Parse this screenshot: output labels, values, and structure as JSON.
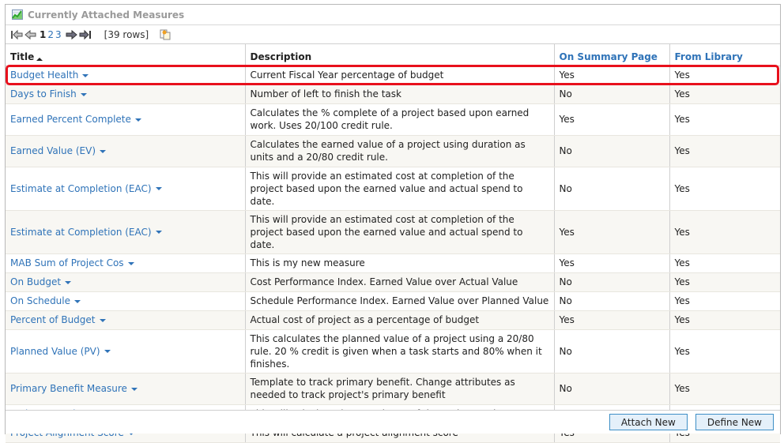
{
  "panel": {
    "title": "Currently Attached Measures",
    "icon": "chart-icon"
  },
  "toolbar": {
    "first_icon": "first-page-icon",
    "prev_icon": "prev-page-icon",
    "pages": [
      "1",
      "2",
      "3"
    ],
    "current_page": "1",
    "next_icon": "next-page-icon",
    "last_icon": "last-page-icon",
    "rows_count": "[39 rows]",
    "export_icon": "export-icon"
  },
  "table": {
    "columns": [
      "Title",
      "Description",
      "On Summary Page",
      "From Library"
    ],
    "sorted_column": "Title",
    "sort_direction": "ascending",
    "highlighted_row": 0,
    "rows": [
      {
        "title": "Budget Health",
        "description": "Current Fiscal Year percentage of budget",
        "summary": "Yes",
        "library": "Yes"
      },
      {
        "title": "Days to Finish",
        "description": "Number of left to finish the task",
        "summary": "No",
        "library": "Yes"
      },
      {
        "title": "Earned Percent Complete",
        "description": "Calculates the % complete of a project based upon earned work. Uses 20/100 credit rule.",
        "summary": "Yes",
        "library": "Yes"
      },
      {
        "title": "Earned Value (EV)",
        "description": "Calculates the earned value of a project using duration as units and a 20/80 credit rule.",
        "summary": "No",
        "library": "Yes"
      },
      {
        "title": "Estimate at Completion (EAC)",
        "description": "This will provide an estimated cost at completion of the project based upon the earned value and actual spend to date.",
        "summary": "No",
        "library": "Yes"
      },
      {
        "title": "Estimate at Completion (EAC)",
        "description": "This will provide an estimated cost at completion of the project based upon the earned value and actual spend to date.",
        "summary": "Yes",
        "library": "Yes"
      },
      {
        "title": "MAB Sum of Project Cos",
        "description": "This is my new measure",
        "summary": "Yes",
        "library": "Yes"
      },
      {
        "title": "On Budget",
        "description": "Cost Performance Index. Earned Value over Actual Value",
        "summary": "No",
        "library": "Yes"
      },
      {
        "title": "On Schedule",
        "description": "Schedule Performance Index. Earned Value over Planned Value",
        "summary": "No",
        "library": "Yes"
      },
      {
        "title": "Percent of Budget",
        "description": "Actual cost of project as a percentage of budget",
        "summary": "Yes",
        "library": "Yes"
      },
      {
        "title": "Planned Value (PV)",
        "description": "This calculates the planned value of a project using a 20/80 rule. 20 % credit is given when a task starts and 80% when it finishes.",
        "summary": "No",
        "library": "Yes"
      },
      {
        "title": "Primary Benefit Measure",
        "description": "Template to track primary benefit. Change attributes as needed to track project's primary benefit",
        "summary": "No",
        "library": "Yes"
      },
      {
        "title": "Project Actual to Date",
        "description": "This will calculate the actual cost of the project to date.",
        "summary": "No",
        "library": "Yes"
      },
      {
        "title": "Project Alignment Score",
        "description": "This will calculate a project alignment score",
        "summary": "Yes",
        "library": "Yes"
      }
    ]
  },
  "footer": {
    "attach_new": "Attach New",
    "define_new": "Define New"
  },
  "colors": {
    "link": "#2f73b8",
    "highlight": "#e8101c",
    "button_bg": "#e4f0fa",
    "button_border": "#3d8fc6",
    "alt_row": "#f8f7f3"
  }
}
